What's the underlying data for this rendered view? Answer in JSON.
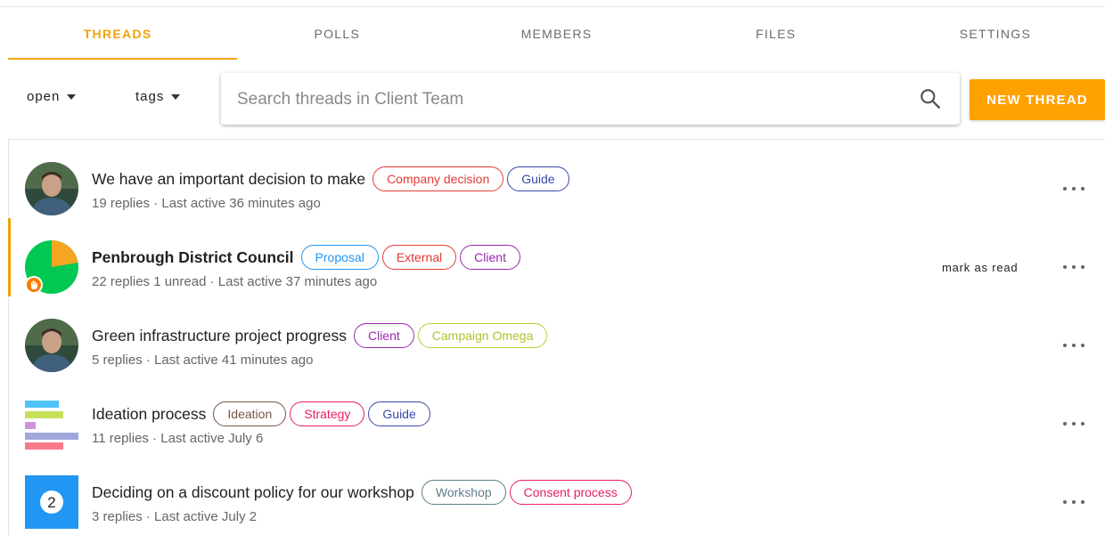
{
  "tabs": [
    {
      "label": "THREADS",
      "active": true
    },
    {
      "label": "POLLS",
      "active": false
    },
    {
      "label": "MEMBERS",
      "active": false
    },
    {
      "label": "FILES",
      "active": false
    },
    {
      "label": "SETTINGS",
      "active": false
    }
  ],
  "filters": {
    "status_label": "open",
    "tags_label": "tags"
  },
  "search": {
    "placeholder": "Search threads in Client Team"
  },
  "new_thread_label": "NEW THREAD",
  "colors": {
    "accent": "#f0a30a",
    "button": "#ffa100"
  },
  "threads": [
    {
      "title": "We have an important decision to make",
      "bold": false,
      "avatar": "person-photo",
      "tags": [
        {
          "label": "Company decision",
          "color": "#e53935"
        },
        {
          "label": "Guide",
          "color": "#3949ab"
        }
      ],
      "meta": "19 replies  · Last active 36 minutes ago"
    },
    {
      "title": "Penbrough District Council",
      "bold": true,
      "unread": true,
      "avatar": "proposal-pie-icon",
      "tags": [
        {
          "label": "Proposal",
          "color": "#2196f3"
        },
        {
          "label": "External",
          "color": "#e53935"
        },
        {
          "label": "Client",
          "color": "#9c27b0"
        }
      ],
      "meta": "22 replies 1 unread · Last active 37 minutes ago",
      "mark_read_label": "mark as read"
    },
    {
      "title": "Green infrastructure project progress",
      "bold": false,
      "avatar": "person-photo",
      "tags": [
        {
          "label": "Client",
          "color": "#9c27b0"
        },
        {
          "label": "Campaign Omega",
          "color": "#c0ca33"
        }
      ],
      "meta": "5 replies  · Last active 41 minutes ago"
    },
    {
      "title": "Ideation process",
      "bold": false,
      "avatar": "bar-chart-icon",
      "tags": [
        {
          "label": "Ideation",
          "color": "#795548"
        },
        {
          "label": "Strategy",
          "color": "#e91e63"
        },
        {
          "label": "Guide",
          "color": "#3949ab"
        }
      ],
      "meta": "11 replies  · Last active July 6"
    },
    {
      "title": "Deciding on a discount policy for our workshop",
      "bold": false,
      "avatar": "count-badge-icon",
      "avatar_count": "2",
      "tags": [
        {
          "label": "Workshop",
          "color": "#607d8b"
        },
        {
          "label": "Consent process",
          "color": "#e91e63"
        }
      ],
      "meta": "3 replies  · Last active July 2"
    }
  ]
}
